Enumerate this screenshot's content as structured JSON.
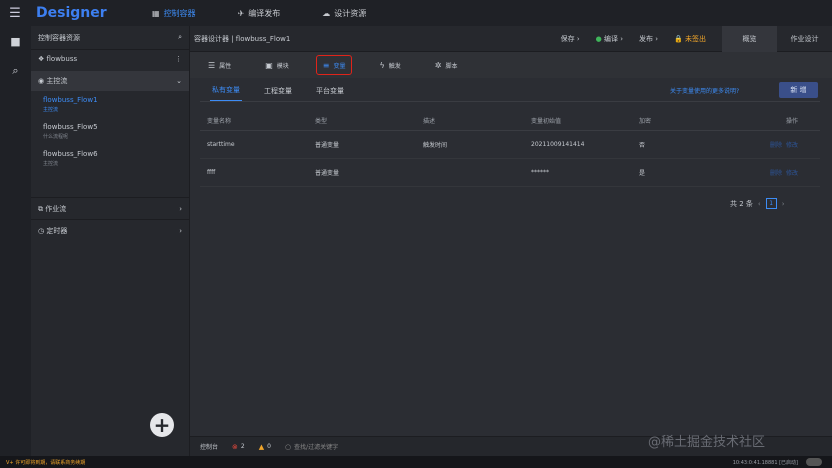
{
  "topbar": {
    "brand": "Designer",
    "nav": [
      {
        "icon": "▦",
        "label": "控制容器"
      },
      {
        "icon": "✈",
        "label": "编译发布"
      },
      {
        "icon": "☁",
        "label": "设计资源"
      }
    ]
  },
  "sidebar": {
    "title": "控制容器资源",
    "project": "flowbuss",
    "section_main": "主控流",
    "flows": [
      {
        "name": "flowbuss_Flow1",
        "sub": "主控流"
      },
      {
        "name": "flowbuss_Flow5",
        "sub": "什么流程呢"
      },
      {
        "name": "flowbuss_Flow6",
        "sub": "主控流"
      }
    ],
    "section_jobs": "作业流",
    "section_timers": "定时器"
  },
  "breadcrumb": "容器设计器 | flowbuss_Flow1",
  "actions": {
    "save": "保存",
    "compile": "编译",
    "publish": "发布",
    "unpublished": "未签出",
    "overview": "概览",
    "job_design": "作业设计"
  },
  "tabs": [
    {
      "icon": "☰",
      "label": "属性"
    },
    {
      "icon": "▣",
      "label": "模块"
    },
    {
      "icon": "≡",
      "label": "变量"
    },
    {
      "icon": "ϟ",
      "label": "触发"
    },
    {
      "icon": "✲",
      "label": "脚本"
    }
  ],
  "subtabs": [
    "私有变量",
    "工程变量",
    "平台变量"
  ],
  "help_link": "关于变量使用的更多说明?",
  "new_button": "新 增",
  "table": {
    "headers": [
      "变量名称",
      "类型",
      "描述",
      "变量初始值",
      "加密",
      "操作"
    ],
    "rows": [
      {
        "name": "starttime",
        "type": "普通变量",
        "desc": "触发时间",
        "init": "20211009141414",
        "enc": "否"
      },
      {
        "name": "ffff",
        "type": "普通变量",
        "desc": "",
        "init": "******",
        "enc": "是"
      }
    ],
    "op_edit": "删除",
    "op_delete": "修改"
  },
  "pager": {
    "total": "共 2 条",
    "prev": "‹",
    "page": "1",
    "next": "›"
  },
  "console": {
    "label": "控制台",
    "errors": "2",
    "warnings": "0",
    "info": "0",
    "search": "查找/过滤关键字"
  },
  "status": {
    "notice": "V+ 许可即将到期，请联系商务续期",
    "right": "10:43:0:41.18881  [已启动]"
  },
  "watermark": "@稀土掘金技术社区"
}
